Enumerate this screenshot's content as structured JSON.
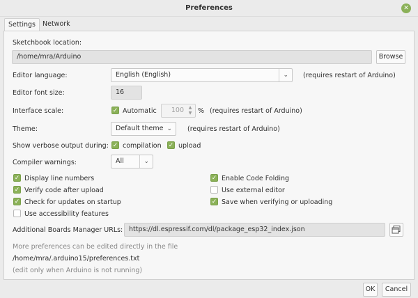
{
  "window": {
    "title": "Preferences",
    "close_glyph": "✕"
  },
  "tabs": [
    {
      "label": "Settings"
    },
    {
      "label": "Network"
    }
  ],
  "sketchbook": {
    "label": "Sketchbook location:",
    "value": "/home/mra/Arduino",
    "browse_label": "Browse"
  },
  "editor_language": {
    "label": "Editor language:",
    "value": "English (English)",
    "note": "(requires restart of Arduino)"
  },
  "font_size": {
    "label": "Editor font size:",
    "value": "16"
  },
  "interface_scale": {
    "label": "Interface scale:",
    "automatic_label": "Automatic",
    "automatic_checked": true,
    "value": "100",
    "unit": "%",
    "note": "(requires restart of Arduino)"
  },
  "theme": {
    "label": "Theme:",
    "value": "Default theme",
    "note": "(requires restart of Arduino)"
  },
  "verbose": {
    "label": "Show verbose output during:",
    "compilation_label": "compilation",
    "compilation_checked": true,
    "upload_label": "upload",
    "upload_checked": true
  },
  "compiler_warnings": {
    "label": "Compiler warnings:",
    "value": "All"
  },
  "options_left": [
    {
      "label": "Display line numbers",
      "checked": true
    },
    {
      "label": "Verify code after upload",
      "checked": true
    },
    {
      "label": "Check for updates on startup",
      "checked": true
    },
    {
      "label": "Use accessibility features",
      "checked": false
    }
  ],
  "options_right": [
    {
      "label": "Enable Code Folding",
      "checked": true
    },
    {
      "label": "Use external editor",
      "checked": false
    },
    {
      "label": "Save when verifying or uploading",
      "checked": true
    }
  ],
  "boards_manager": {
    "label": "Additional Boards Manager URLs:",
    "value": "https://dl.espressif.com/dl/package_esp32_index.json",
    "icon": "window-list-icon"
  },
  "info": {
    "line1": "More preferences can be edited directly in the file",
    "line2": "/home/mra/.arduino15/preferences.txt",
    "line3": "(edit only when Arduino is not running)"
  },
  "footer": {
    "ok_label": "OK",
    "cancel_label": "Cancel"
  },
  "colors": {
    "accent": "#8bb158",
    "panel": "#f7f7f7",
    "window": "#ebebeb"
  }
}
